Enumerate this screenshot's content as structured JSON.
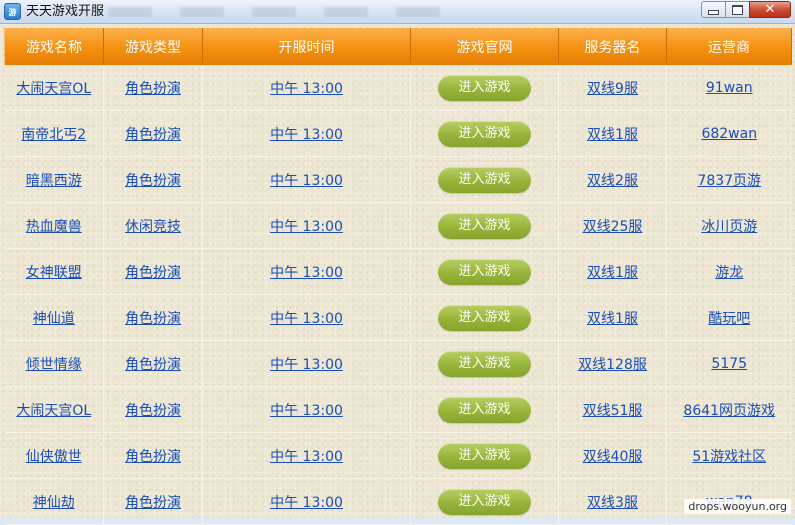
{
  "window": {
    "title": "天天游戏开服",
    "icon_label": "游戏",
    "close_glyph": "✕"
  },
  "table": {
    "headers": [
      "游戏名称",
      "游戏类型",
      "开服时间",
      "游戏官网",
      "服务器名",
      "运营商"
    ],
    "rows": [
      {
        "name": "大闹天宫OL",
        "type": "角色扮演",
        "time": "中午 13:00",
        "button": "进入游戏",
        "server": "双线9服",
        "operator": "91wan"
      },
      {
        "name": "南帝北丐2",
        "type": "角色扮演",
        "time": "中午 13:00",
        "button": "进入游戏",
        "server": "双线1服",
        "operator": "682wan"
      },
      {
        "name": "暗黑西游",
        "type": "角色扮演",
        "time": "中午 13:00",
        "button": "进入游戏",
        "server": "双线2服",
        "operator": "7837页游"
      },
      {
        "name": "热血魔兽",
        "type": "休闲竞技",
        "time": "中午 13:00",
        "button": "进入游戏",
        "server": "双线25服",
        "operator": "冰川页游"
      },
      {
        "name": "女神联盟",
        "type": "角色扮演",
        "time": "中午 13:00",
        "button": "进入游戏",
        "server": "双线1服",
        "operator": "游龙"
      },
      {
        "name": "神仙道",
        "type": "角色扮演",
        "time": "中午 13:00",
        "button": "进入游戏",
        "server": "双线1服",
        "operator": "酷玩吧"
      },
      {
        "name": "倾世情缘",
        "type": "角色扮演",
        "time": "中午 13:00",
        "button": "进入游戏",
        "server": "双线128服",
        "operator": "5175"
      },
      {
        "name": "大闹天宫OL",
        "type": "角色扮演",
        "time": "中午 13:00",
        "button": "进入游戏",
        "server": "双线51服",
        "operator": "8641网页游戏"
      },
      {
        "name": "仙侠傲世",
        "type": "角色扮演",
        "time": "中午 13:00",
        "button": "进入游戏",
        "server": "双线40服",
        "operator": "51游戏社区"
      },
      {
        "name": "神仙劫",
        "type": "角色扮演",
        "time": "中午 13:00",
        "button": "进入游戏",
        "server": "双线3服",
        "operator": "wan78"
      }
    ]
  },
  "watermark": "drops.wooyun.org",
  "colors": {
    "header_orange": "#f4900f",
    "link_blue": "#1b4fb5",
    "button_green": "#97b43a",
    "background": "#ede6d3"
  }
}
